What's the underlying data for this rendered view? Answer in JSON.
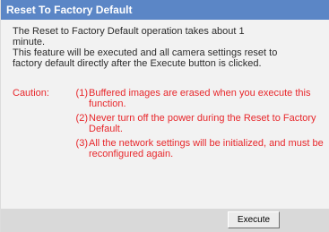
{
  "header": {
    "title": "Reset To Factory Default"
  },
  "description": {
    "line1": "The Reset to Factory Default operation takes about 1",
    "line2": "minute.",
    "line3": "This feature will be executed and all camera settings reset to",
    "line4": "factory default directly after the Execute button is clicked."
  },
  "caution": {
    "label": "Caution:",
    "items": [
      {
        "num": "(1)",
        "text": "Buffered images are erased when you execute this function."
      },
      {
        "num": "(2)",
        "text": "Never turn off the power during the Reset to Factory Default."
      },
      {
        "num": "(3)",
        "text": "All the network settings will be initialized, and must be reconfigured again."
      }
    ]
  },
  "actions": {
    "execute_label": "Execute"
  },
  "colors": {
    "title_bar": "#5b86c6",
    "caution_text": "#e8272b",
    "panel_bg": "#f2f2f2",
    "footer_bg": "#d9d9d9"
  }
}
